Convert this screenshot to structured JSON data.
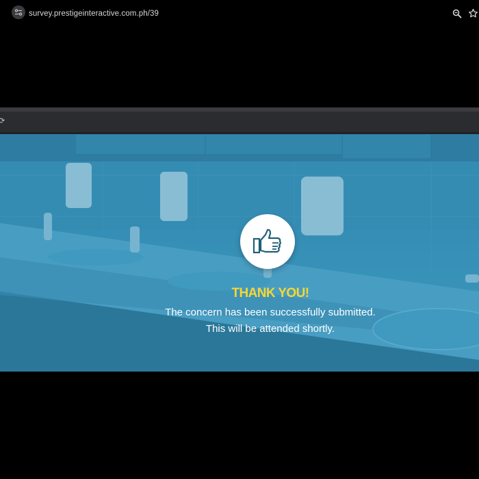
{
  "browser": {
    "url": "survey.prestigeinteractive.com.ph/39",
    "icons": [
      "site-info-icon",
      "zoom-icon",
      "star-icon"
    ]
  },
  "page": {
    "heading": "THANK YOU!",
    "line1": "The concern has been successfully submitted.",
    "line2": "This will be attended shortly.",
    "icon": "thumbs-up-icon",
    "colors": {
      "heading": "#f7d731",
      "overlay": "#3a92b8",
      "icon": "#1f5f7a"
    }
  }
}
